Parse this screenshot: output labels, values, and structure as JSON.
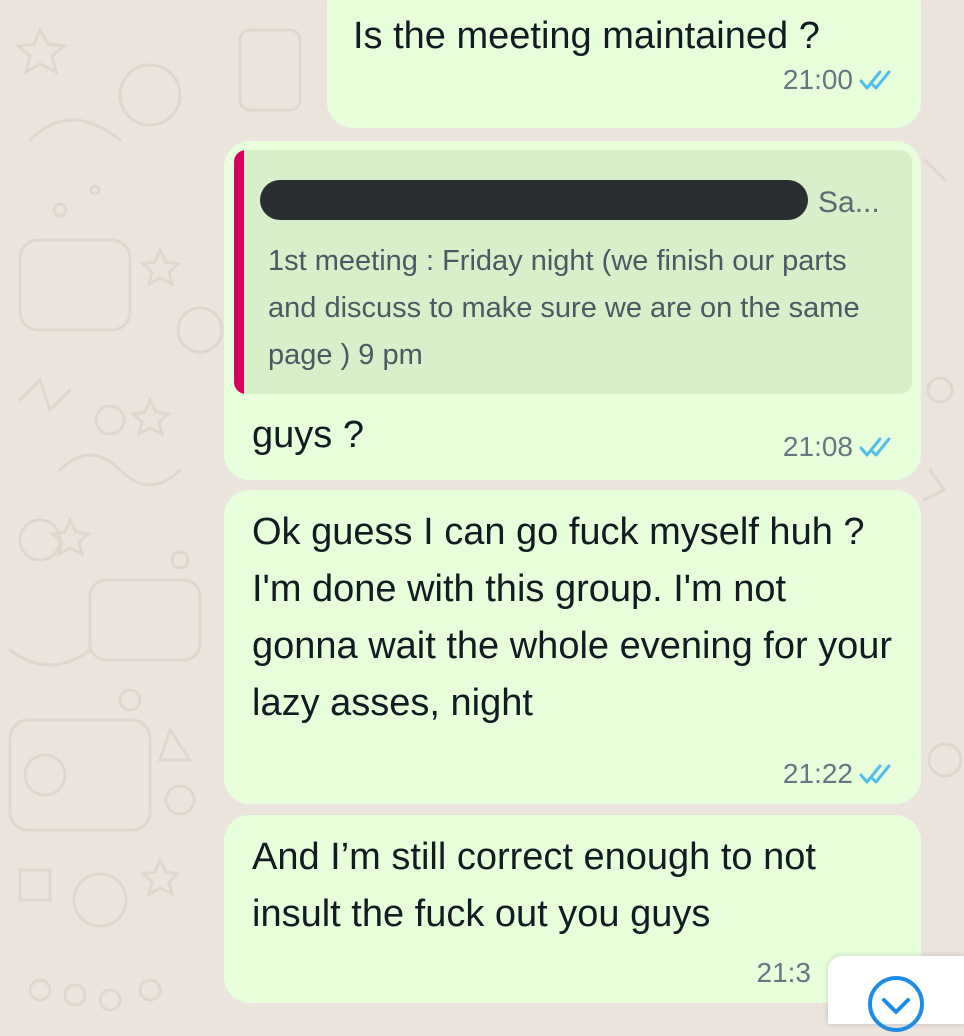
{
  "chat": {
    "messages": [
      {
        "text": "Is the meeting maintained ?",
        "time": "21:00",
        "status": "read"
      },
      {
        "quote": {
          "author_visible": "Sa...",
          "text": "1st meeting : Friday night (we finish our parts and discuss to make sure we are on the same page ) 9 pm"
        },
        "text": "guys ?",
        "time": "21:08",
        "status": "read"
      },
      {
        "text": "Ok guess I can go fuck myself huh ? I'm done with this group. I'm not gonna wait the whole evening for your lazy asses, night",
        "time": "21:22",
        "status": "read"
      },
      {
        "text": "And I’m still correct enough to not insult the fuck out you guys",
        "time": "21:3",
        "status": "partially-hidden"
      }
    ]
  },
  "colors": {
    "outgoing_bubble": "#E7FFDB",
    "quote_background": "#D8F0C9",
    "quote_accent": "#D6005C",
    "read_ticks": "#53BDEB",
    "wallpaper": "#ECE5DD"
  },
  "icons": {
    "read_receipt": "double-check-icon",
    "scroll_button": "chevron-down-circle-icon"
  }
}
